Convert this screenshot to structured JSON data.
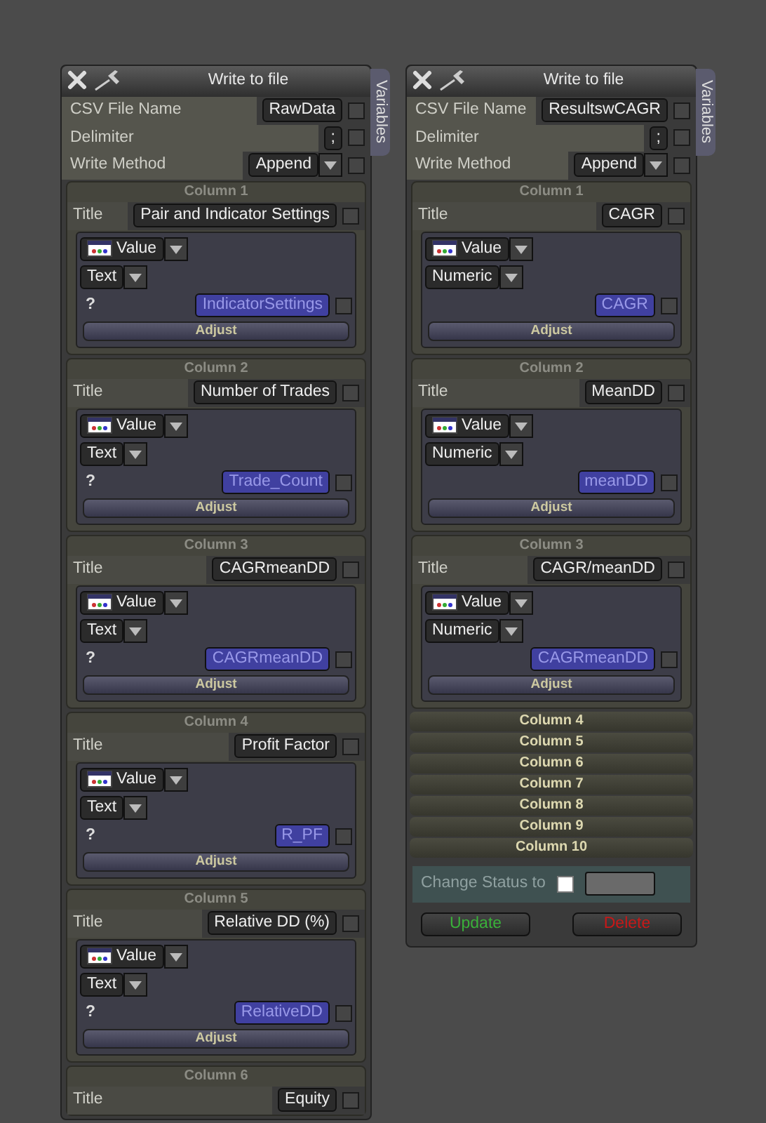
{
  "panels": [
    {
      "title": "Write to file",
      "side_tab": "Variables",
      "fields": [
        {
          "label": "CSV File Name",
          "value": "RawData",
          "kind": "text",
          "checked": false
        },
        {
          "label": "Delimiter",
          "value": ";",
          "kind": "text",
          "checked": false
        },
        {
          "label": "Write Method",
          "value": "Append",
          "kind": "select",
          "checked": false
        }
      ],
      "columns": [
        {
          "header": "Column 1",
          "expanded": true,
          "title_label": "Title",
          "title": "Pair and Indicator Settings",
          "title_checked": false,
          "source": "Value",
          "type": "Text",
          "hint": "?",
          "variable": "IndicatorSettings",
          "variable_checked": false,
          "adjust": "Adjust"
        },
        {
          "header": "Column 2",
          "expanded": true,
          "title_label": "Title",
          "title": "Number of Trades",
          "title_checked": false,
          "source": "Value",
          "type": "Text",
          "hint": "?",
          "variable": "Trade_Count",
          "variable_checked": false,
          "adjust": "Adjust"
        },
        {
          "header": "Column 3",
          "expanded": true,
          "title_label": "Title",
          "title": "CAGRmeanDD",
          "title_checked": false,
          "source": "Value",
          "type": "Text",
          "hint": "?",
          "variable": "CAGRmeanDD",
          "variable_checked": false,
          "adjust": "Adjust"
        },
        {
          "header": "Column 4",
          "expanded": true,
          "title_label": "Title",
          "title": "Profit Factor",
          "title_checked": false,
          "source": "Value",
          "type": "Text",
          "hint": "?",
          "variable": "R_PF",
          "variable_checked": false,
          "adjust": "Adjust"
        },
        {
          "header": "Column 5",
          "expanded": true,
          "title_label": "Title",
          "title": "Relative DD (%)",
          "title_checked": false,
          "source": "Value",
          "type": "Text",
          "hint": "?",
          "variable": "RelativeDD",
          "variable_checked": false,
          "adjust": "Adjust"
        },
        {
          "header": "Column 6",
          "expanded": true,
          "title_label": "Title",
          "title": "Equity",
          "title_checked": false
        }
      ]
    },
    {
      "title": "Write to file",
      "side_tab": "Variables",
      "fields": [
        {
          "label": "CSV File Name",
          "value": "ResultswCAGR",
          "kind": "text",
          "checked": false
        },
        {
          "label": "Delimiter",
          "value": ";",
          "kind": "text",
          "checked": false
        },
        {
          "label": "Write Method",
          "value": "Append",
          "kind": "select",
          "checked": false
        }
      ],
      "columns": [
        {
          "header": "Column 1",
          "expanded": true,
          "title_label": "Title",
          "title": "CAGR",
          "title_checked": false,
          "source": "Value",
          "type": "Numeric",
          "variable": "CAGR",
          "variable_checked": false,
          "adjust": "Adjust"
        },
        {
          "header": "Column 2",
          "expanded": true,
          "title_label": "Title",
          "title": "MeanDD",
          "title_checked": false,
          "source": "Value",
          "type": "Numeric",
          "variable": "meanDD",
          "variable_checked": false,
          "adjust": "Adjust"
        },
        {
          "header": "Column 3",
          "expanded": true,
          "title_label": "Title",
          "title": "CAGR/meanDD",
          "title_checked": false,
          "source": "Value",
          "type": "Numeric",
          "variable": "CAGRmeanDD",
          "variable_checked": false,
          "adjust": "Adjust"
        },
        {
          "header": "Column 4",
          "expanded": false
        },
        {
          "header": "Column 5",
          "expanded": false
        },
        {
          "header": "Column 6",
          "expanded": false
        },
        {
          "header": "Column 7",
          "expanded": false
        },
        {
          "header": "Column 8",
          "expanded": false
        },
        {
          "header": "Column 9",
          "expanded": false
        },
        {
          "header": "Column 10",
          "expanded": false
        }
      ],
      "status": {
        "label": "Change Status to",
        "checked": false
      },
      "buttons": [
        {
          "label": "Update",
          "kind": "update"
        },
        {
          "label": "Delete",
          "kind": "delete"
        }
      ]
    }
  ]
}
